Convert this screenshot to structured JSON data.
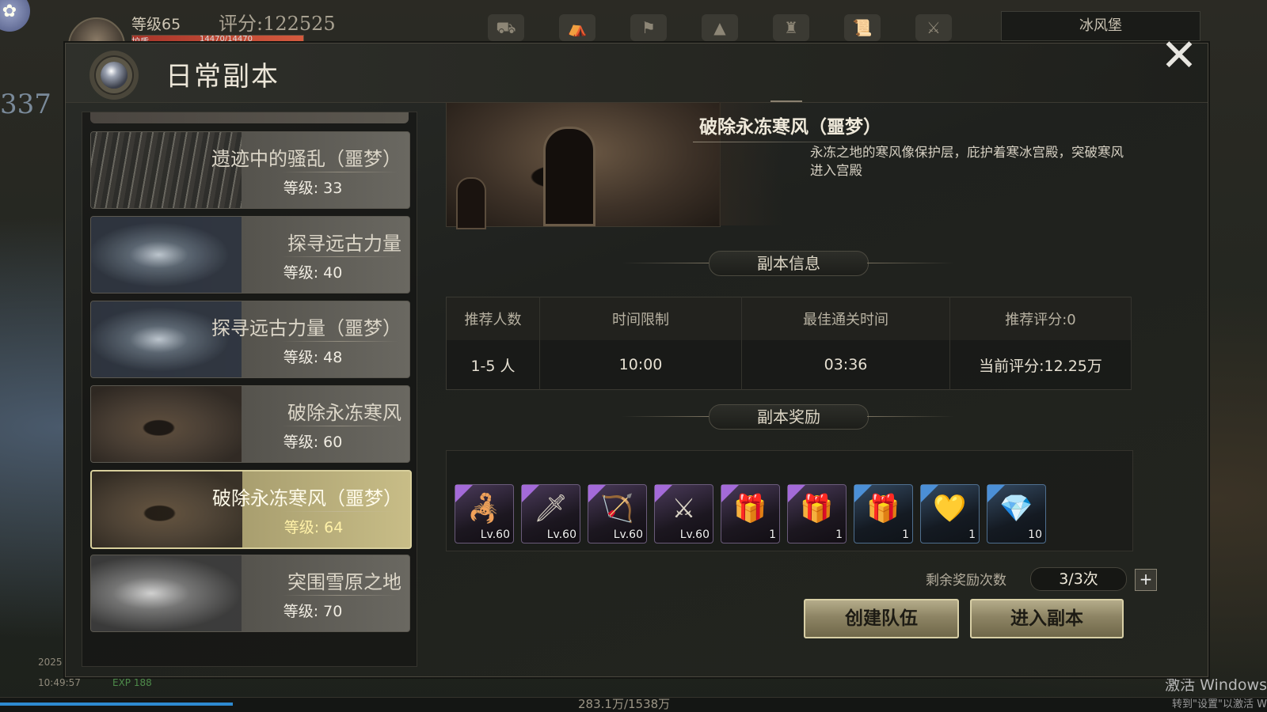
{
  "hud": {
    "level": "等级65",
    "score": "评分:122525",
    "hp_label": "护盾",
    "hp_value": "14470/14470",
    "power_fragment": "337",
    "location": "冰风堡",
    "date_fragment": "2025",
    "time": "10:49:57",
    "exp_label": "EXP 188",
    "exp_progress": "283.1万/1538万",
    "exp_fraction": 0.184,
    "icons": [
      "tank-icon",
      "camp-icon",
      "guild-icon",
      "tent-icon",
      "castle-icon",
      "scroll-icon",
      "sword-icon"
    ]
  },
  "watermark": {
    "line1": "激活 Windows",
    "line2": "转到\"设置\"以激活 W"
  },
  "dialog": {
    "title": "日常副本",
    "close_icon": "close-icon"
  },
  "dungeons": [
    {
      "name": "遗迹中的骚乱（噩梦）",
      "level": "等级: 33",
      "thumb": "throne",
      "selected": false
    },
    {
      "name": "探寻远古力量",
      "level": "等级: 40",
      "thumb": "tower",
      "selected": false
    },
    {
      "name": "探寻远古力量（噩梦）",
      "level": "等级: 48",
      "thumb": "tower",
      "selected": false
    },
    {
      "name": "破除永冻寒风",
      "level": "等级: 60",
      "thumb": "castle",
      "selected": false
    },
    {
      "name": "破除永冻寒风（噩梦）",
      "level": "等级: 64",
      "thumb": "castle",
      "selected": true
    },
    {
      "name": "突围雪原之地",
      "level": "等级: 70",
      "thumb": "dragon",
      "selected": false
    }
  ],
  "detail": {
    "title": "破除永冻寒风（噩梦）",
    "description": "永冻之地的寒风像保护层，庇护着寒冰宫殿，突破寒风进入宫殿"
  },
  "info": {
    "section_title": "副本信息",
    "headers": [
      "推荐人数",
      "时间限制",
      "最佳通关时间",
      "推荐评分:0"
    ],
    "values": [
      "1-5 人",
      "10:00",
      "03:36",
      "当前评分:12.25万"
    ]
  },
  "rewards": {
    "section_title": "副本奖励",
    "items": [
      {
        "icon": "scorpion-weapon-icon",
        "label": "Lv.60",
        "rarity": "purple",
        "glyph": "🦂"
      },
      {
        "icon": "spear-icon",
        "label": "Lv.60",
        "rarity": "purple",
        "glyph": "🗡"
      },
      {
        "icon": "crossbow-icon",
        "label": "Lv.60",
        "rarity": "purple",
        "glyph": "🏹"
      },
      {
        "icon": "blade-icon",
        "label": "Lv.60",
        "rarity": "purple",
        "glyph": "⚔"
      },
      {
        "icon": "purple-chest-icon",
        "label": "1",
        "rarity": "purple",
        "glyph": "🎁"
      },
      {
        "icon": "purple-chest-icon",
        "label": "1",
        "rarity": "purple",
        "glyph": "🎁"
      },
      {
        "icon": "purple-chest-icon",
        "label": "1",
        "rarity": "blue",
        "glyph": "🎁"
      },
      {
        "icon": "gold-ore-icon",
        "label": "1",
        "rarity": "blue",
        "glyph": "💛"
      },
      {
        "icon": "crystal-icon",
        "label": "10",
        "rarity": "blue",
        "glyph": "💎"
      }
    ],
    "remaining_label": "剩余奖励次数",
    "remaining_value": "3/3次",
    "plus_label": "+"
  },
  "buttons": {
    "create_team": "创建队伍",
    "enter_dungeon": "进入副本"
  },
  "colors": {
    "accent_gold": "#c8bd87",
    "rarity_purple": "#a36ad8",
    "rarity_blue": "#4b8fd6"
  }
}
